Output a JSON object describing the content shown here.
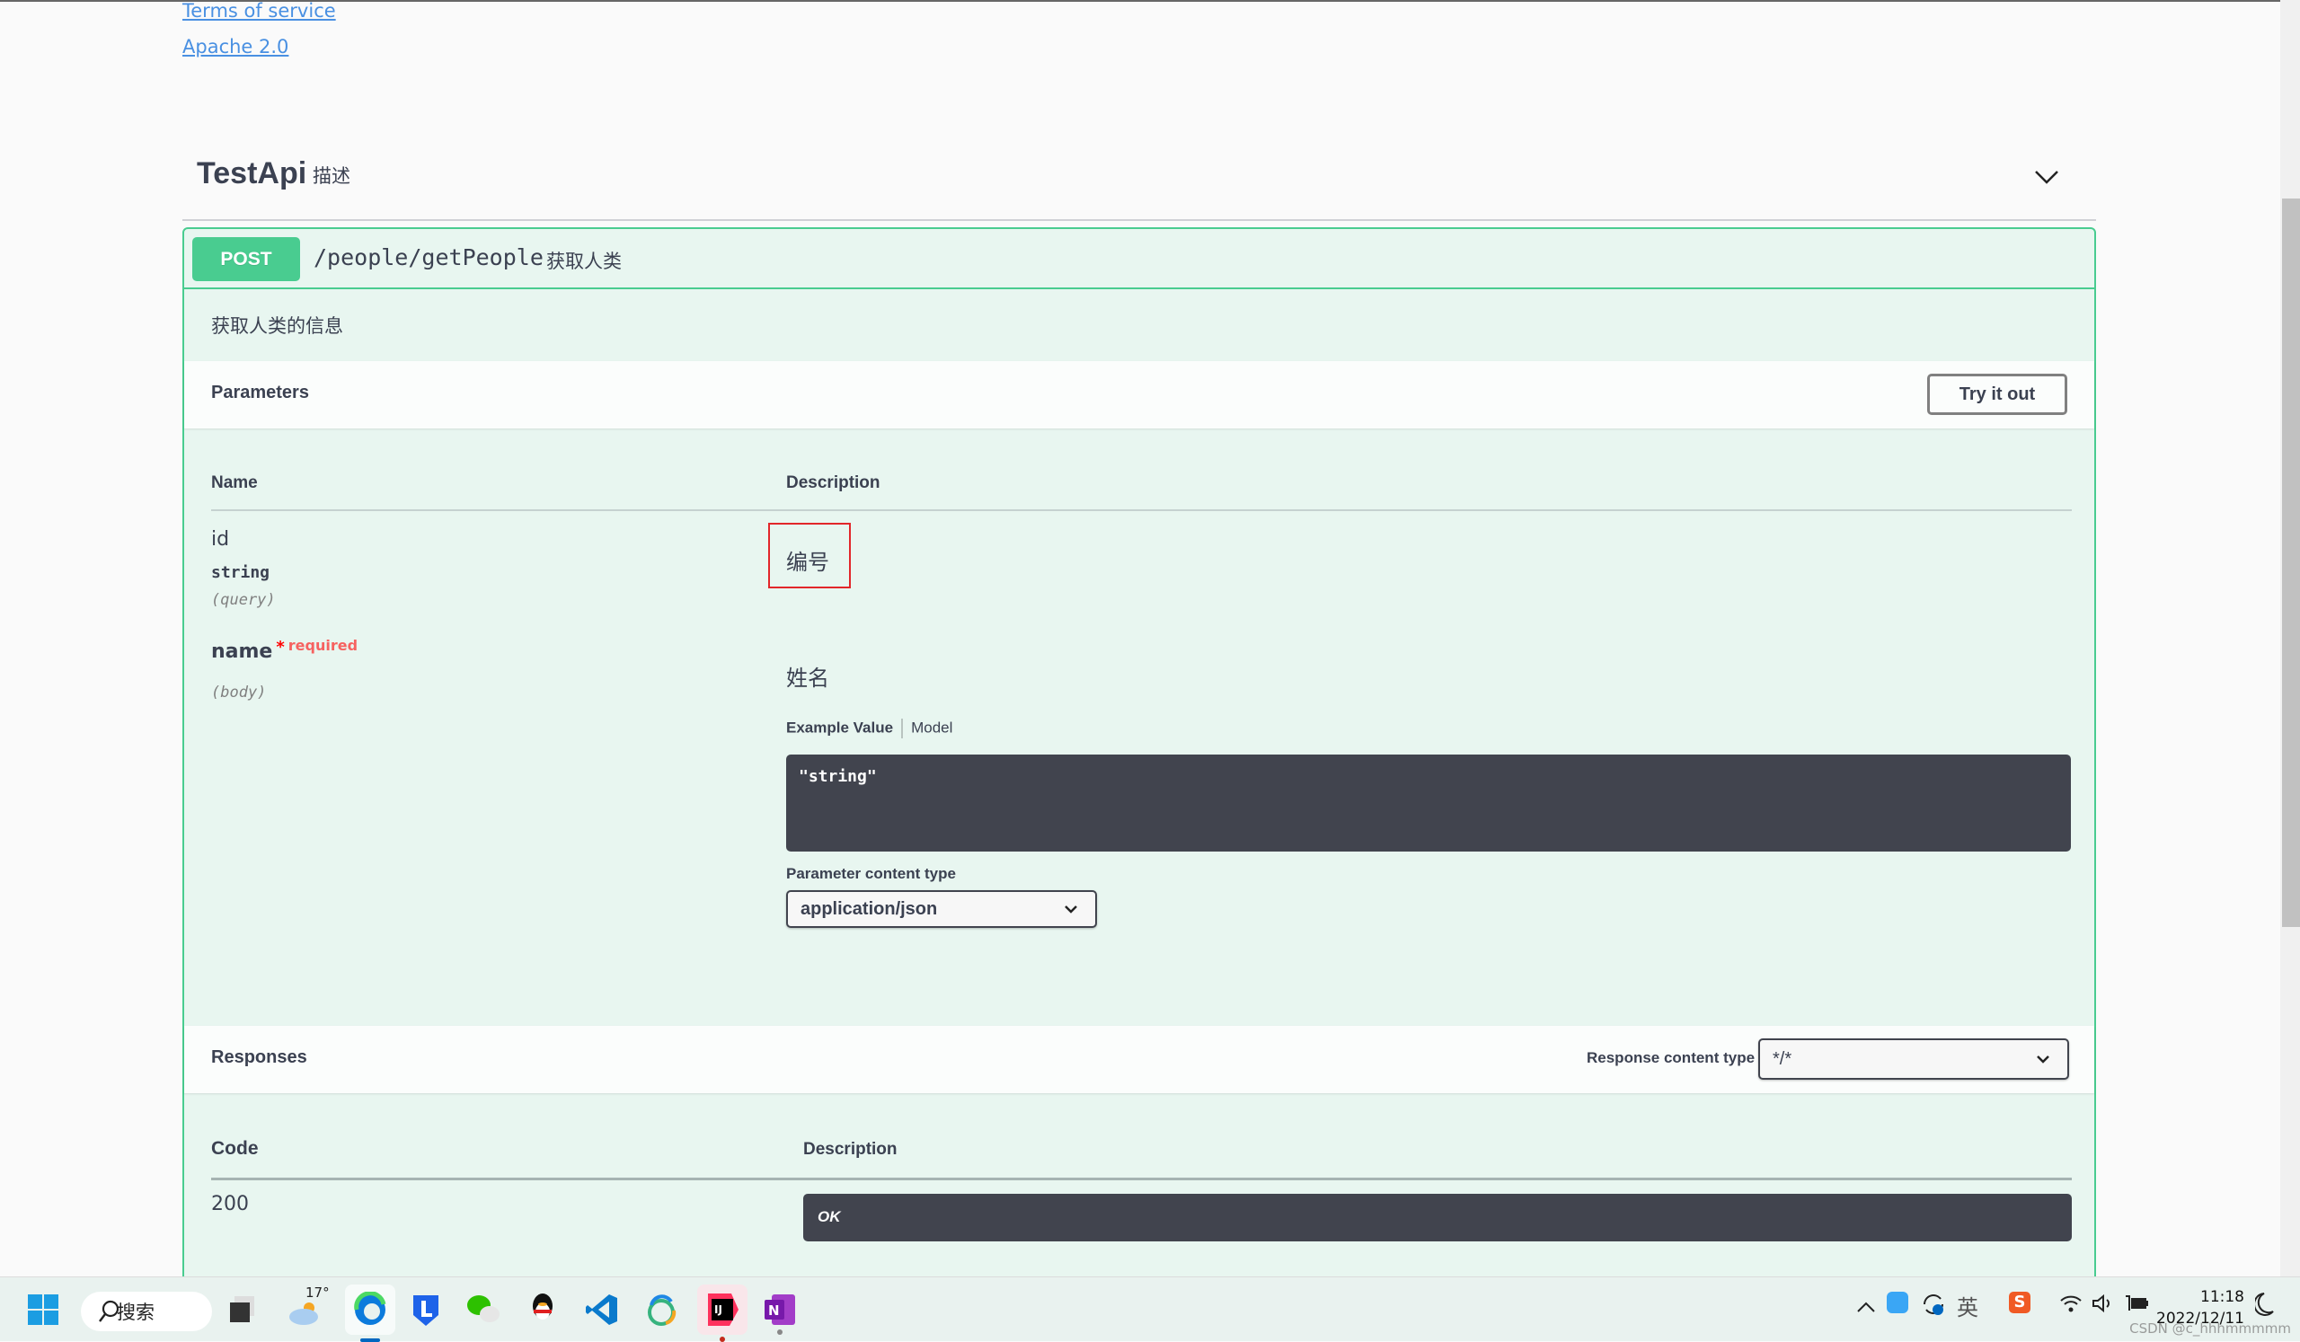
{
  "info": {
    "terms_link": "Terms of service",
    "license_link": "Apache 2.0"
  },
  "tag": {
    "name": "TestApi",
    "description": "描述"
  },
  "operation": {
    "method": "POST",
    "path": "/people/getPeople",
    "summary": "获取人类",
    "description": "获取人类的信息",
    "method_color": "#49cc90"
  },
  "parameters": {
    "title": "Parameters",
    "try_button": "Try it out",
    "col_name": "Name",
    "col_description": "Description",
    "items": [
      {
        "name": "id",
        "type": "string",
        "in": "(query)",
        "description": "编号",
        "required": false
      },
      {
        "name": "name",
        "required_star": "*",
        "required_label": "required",
        "in": "(body)",
        "description": "姓名",
        "required": true
      }
    ],
    "example_tab": "Example Value",
    "model_tab": "Model",
    "example_value": "\"string\"",
    "content_type_label": "Parameter content type",
    "content_type_value": "application/json"
  },
  "responses": {
    "title": "Responses",
    "content_type_label": "Response content type",
    "content_type_value": "*/*",
    "col_code": "Code",
    "col_description": "Description",
    "rows": [
      {
        "code": "200",
        "description": "OK"
      }
    ]
  },
  "taskbar": {
    "search_label": "搜索",
    "weather_temp": "17°",
    "apps": [
      "start-icon",
      "search",
      "task-view-icon",
      "weather-icon",
      "edge-icon",
      "lark-icon",
      "wechat-icon",
      "qq-icon",
      "vscode-icon",
      "navicat-icon",
      "intellij-icon",
      "onenote-icon"
    ],
    "tray": {
      "ime_label": "英",
      "time": "11:18",
      "date": "2022/12/11"
    },
    "watermark": "CSDN @c_hhhmmmmm"
  }
}
